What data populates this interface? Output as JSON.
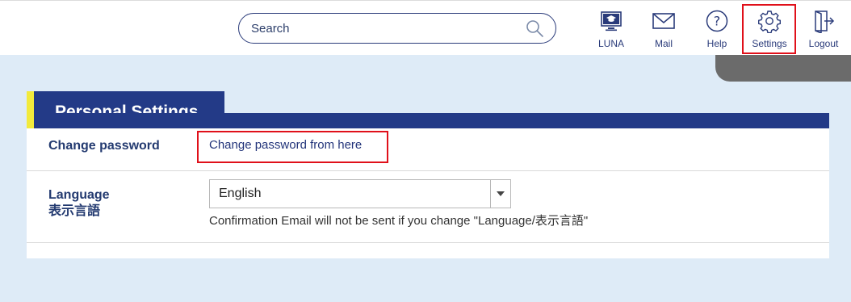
{
  "header": {
    "search": {
      "placeholder": "Search"
    },
    "nav": [
      {
        "label": "LUNA",
        "icon": "luna-monitor-icon"
      },
      {
        "label": "Mail",
        "icon": "mail-icon"
      },
      {
        "label": "Help",
        "icon": "help-icon"
      },
      {
        "label": "Settings",
        "icon": "gear-icon"
      },
      {
        "label": "Logout",
        "icon": "logout-icon"
      }
    ]
  },
  "page": {
    "title": "Personal Settings"
  },
  "settings": {
    "password": {
      "label": "Change password",
      "link_text": "Change password from here"
    },
    "language": {
      "label_en": "Language",
      "label_ja": "表示言語",
      "selected": "English",
      "note": "Confirmation Email will not be sent if you change \"Language/表示言語\""
    }
  },
  "colors": {
    "navy": "#233a87",
    "accent_yellow": "#f2ea3c",
    "background": "#deebf7",
    "highlight_red": "#e0101a"
  }
}
